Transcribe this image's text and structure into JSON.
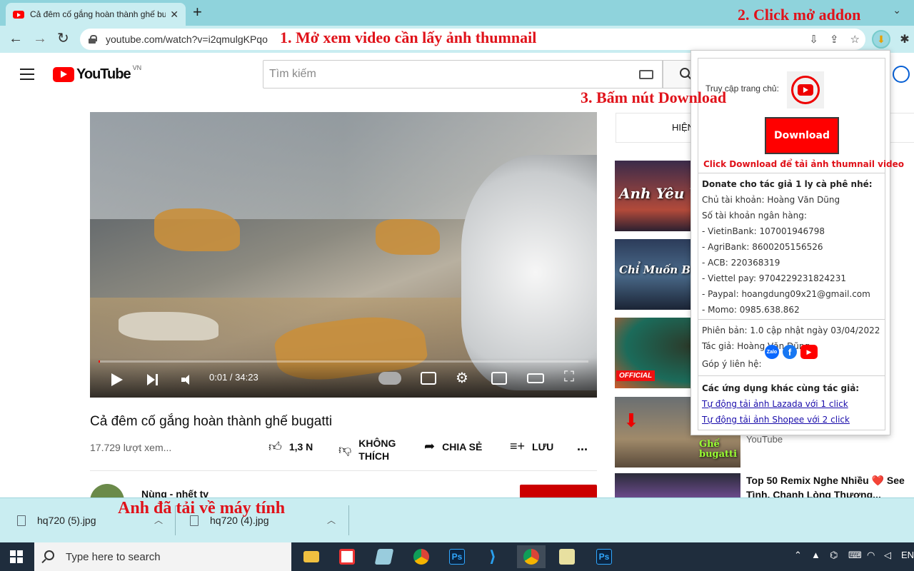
{
  "browser": {
    "tab_title": "Cả đêm cố gắng hoàn thành ghế bugatti",
    "url": "youtube.com/watch?v=i2qmulgKPqo"
  },
  "annotations": {
    "step1": "1. Mở xem video cần lấy ảnh thumnail",
    "step2": "2. Click mở addon",
    "step3": "3. Bấm nút Download",
    "downloaded": "Anh đã tải về máy tính"
  },
  "youtube": {
    "logo_text": "YouTube",
    "region": "VN",
    "search_placeholder": "Tìm kiếm",
    "player": {
      "time_current": "0:01",
      "time_total": "34:23",
      "progress": 0.0005
    },
    "video_title": "Cả đêm cố gắng hoàn thành ghế bugatti",
    "views": "17.729 lượt xem...",
    "actions": {
      "like_count": "1,3 N",
      "dislike_line1": "KHÔNG",
      "dislike_line2": "THÍCH",
      "share": "CHIA SẺ",
      "save": "LƯU",
      "more": "..."
    },
    "channel_name": "Nùng - nhết tv",
    "sidebar": {
      "chip_label": "HIỆN",
      "thumb1_text": "Anh Yêu V",
      "thumb2_text": "Chỉ Muốn Bên Anh",
      "thumb3_badge": "OFFICIAL",
      "thumb4_text": "Ghế bugatti",
      "youtube_label": "YouTube",
      "last_title": "Top 50 Remix Nghe Nhiều ❤️ See Tình, Chanh Lòng Thương..."
    }
  },
  "addon": {
    "home_label": "Truy cập trang chủ:",
    "download_button": "Download",
    "download_note": "Click Download để tải ảnh thumnail video",
    "donate_heading": "Donate cho tác giả 1 ly cà phê nhé:",
    "account_owner": "Chủ tài khoản: Hoàng Văn Dũng",
    "bank_heading": "Số tài khoản ngân hàng:",
    "banks": [
      "- VietinBank: 107001946798",
      "- AgriBank: 8600205156526",
      "- ACB: 220368319",
      "- Viettel pay: 9704229231824231",
      "- Paypal: hoangdung09x21@gmail.com",
      "- Momo: 0985.638.862"
    ],
    "version": "Phiên bản: 1.0 cập nhật ngày 03/04/2022",
    "author": "Tác giả: Hoàng Văn Dũng.",
    "contact_label": "Góp ý liên hệ:",
    "zalo_label": "Zalo",
    "other_apps_heading": "Các ứng dụng khác cùng tác giả:",
    "links": [
      "Tự động tải ảnh Lazada với 1 click",
      "Tự động tải ảnh Shopee với 2 click"
    ]
  },
  "downloads": [
    {
      "name": "hq720 (5).jpg"
    },
    {
      "name": "hq720 (4).jpg"
    }
  ],
  "taskbar": {
    "search_placeholder": "Type here to search",
    "ps_label": "Ps",
    "lang": "EN"
  },
  "colors": {
    "annotation_red": "#e0121a",
    "youtube_red": "#ff0000",
    "chrome_tab": "#8fd3dc",
    "chrome_toolbar": "#c9edf1",
    "taskbar": "#1f2d3d"
  }
}
